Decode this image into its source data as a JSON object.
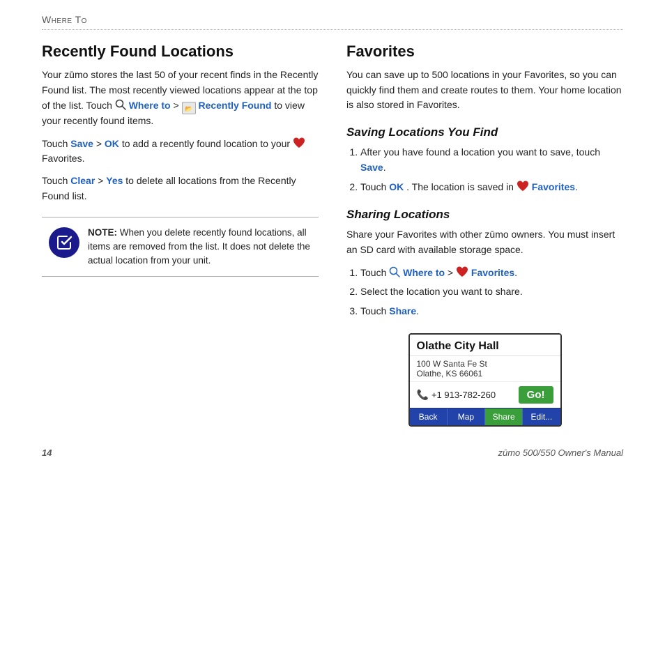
{
  "header": {
    "label": "Where To"
  },
  "left_column": {
    "title": "Recently Found Locations",
    "paragraph1": "Your zūmo stores the last 50 of your recent finds in the Recently Found list. The most recently viewed locations appear at the top of the list. Touch",
    "where_to_link": "Where to",
    "recently_found_link": "Recently Found",
    "paragraph1_end": "to view your recently found items.",
    "paragraph2_start": "Touch",
    "save_link": "Save",
    "ok_link": "OK",
    "paragraph2_end": "to add a recently found location to your",
    "favorites_word": "Favorites.",
    "paragraph3_start": "Touch",
    "clear_link": "Clear",
    "yes_link": "Yes",
    "paragraph3_end": "to delete all locations from the Recently Found list.",
    "note_label": "NOTE:",
    "note_text": "When you delete recently found locations, all items are removed from the list. It does not delete the actual location from your unit."
  },
  "right_column": {
    "favorites_title": "Favorites",
    "favorites_para": "You can save up to 500 locations in your Favorites, so you can quickly find them and create routes to them. Your home location is also stored in Favorites.",
    "saving_title": "Saving Locations You Find",
    "saving_step1_start": "After you have found a location you want to save, touch",
    "saving_step1_link": "Save",
    "saving_step1_end": ".",
    "saving_step2_start": "Touch",
    "saving_step2_ok": "OK",
    "saving_step2_mid": ". The location is saved in",
    "saving_step2_link": "Favorites",
    "saving_step2_end": ".",
    "sharing_title": "Sharing Locations",
    "sharing_para": "Share your Favorites with other zūmo owners. You must insert an SD card with available storage space.",
    "sharing_step1_touch": "Touch",
    "sharing_step1_where": "Where to",
    "sharing_step1_mid": ">",
    "sharing_step1_fav": "Favorites",
    "sharing_step1_end": ".",
    "sharing_step2": "Select the location you want to share.",
    "sharing_step3_start": "Touch",
    "sharing_step3_link": "Share",
    "sharing_step3_end": ".",
    "device": {
      "city": "Olathe City Hall",
      "address_line1": "100 W Santa Fe St",
      "address_line2": "Olathe, KS 66061",
      "phone": "+1 913-782-260",
      "go_label": "Go!",
      "nav_back": "Back",
      "nav_map": "Map",
      "nav_share": "Share",
      "nav_edit": "Edit..."
    }
  },
  "footer": {
    "page_number": "14",
    "manual_name": "zūmo 500/550 Owner's Manual"
  }
}
